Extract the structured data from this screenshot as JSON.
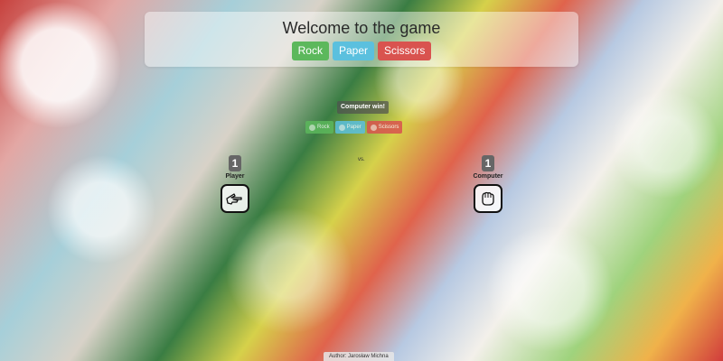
{
  "header": {
    "title": "Welcome to the game"
  },
  "choices": {
    "rock": "Rock",
    "paper": "Paper",
    "scissors": "Scissors"
  },
  "result": {
    "text": "Computer win!"
  },
  "mini": {
    "rock": "Rock",
    "paper": "Paper",
    "scissors": "Scissors"
  },
  "vs": "vs.",
  "player": {
    "score": "1",
    "label": "Player",
    "hand_icon": "scissors-hand-icon"
  },
  "computer": {
    "score": "1",
    "label": "Computer",
    "hand_icon": "rock-hand-icon"
  },
  "footer": {
    "author": "Author: Jarosław Michna"
  },
  "colors": {
    "rock": "#5cb85c",
    "paper": "#5bc0de",
    "scissors": "#d9534f"
  }
}
